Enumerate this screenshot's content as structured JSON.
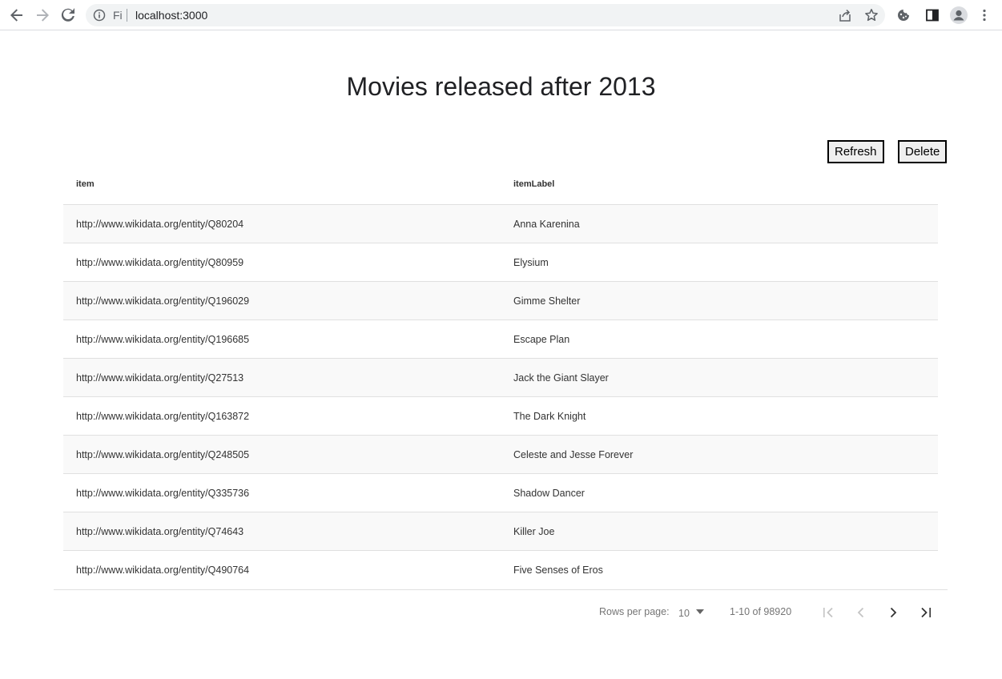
{
  "browser": {
    "site_info": "Fi",
    "url": "localhost:3000"
  },
  "page": {
    "title": "Movies released after 2013",
    "refresh_label": "Refresh",
    "delete_label": "Delete"
  },
  "table": {
    "headers": [
      "item",
      "itemLabel"
    ],
    "rows": [
      {
        "item": "http://www.wikidata.org/entity/Q80204",
        "label": "Anna Karenina"
      },
      {
        "item": "http://www.wikidata.org/entity/Q80959",
        "label": "Elysium"
      },
      {
        "item": "http://www.wikidata.org/entity/Q196029",
        "label": "Gimme Shelter"
      },
      {
        "item": "http://www.wikidata.org/entity/Q196685",
        "label": "Escape Plan"
      },
      {
        "item": "http://www.wikidata.org/entity/Q27513",
        "label": "Jack the Giant Slayer"
      },
      {
        "item": "http://www.wikidata.org/entity/Q163872",
        "label": "The Dark Knight"
      },
      {
        "item": "http://www.wikidata.org/entity/Q248505",
        "label": "Celeste and Jesse Forever"
      },
      {
        "item": "http://www.wikidata.org/entity/Q335736",
        "label": "Shadow Dancer"
      },
      {
        "item": "http://www.wikidata.org/entity/Q74643",
        "label": "Killer Joe"
      },
      {
        "item": "http://www.wikidata.org/entity/Q490764",
        "label": "Five Senses of Eros"
      }
    ]
  },
  "pagination": {
    "rows_per_page_label": "Rows per page:",
    "rows_per_page_value": "10",
    "range_text": "1-10 of 98920"
  },
  "icons": {
    "back": "arrow-left-icon",
    "forward": "arrow-right-icon",
    "reload": "reload-icon",
    "info": "info-icon",
    "share": "share-icon",
    "star": "star-icon",
    "extensions": "cookie-icon",
    "sidepanel": "side-panel-icon",
    "profile": "profile-icon",
    "menu": "kebab-menu-icon"
  }
}
